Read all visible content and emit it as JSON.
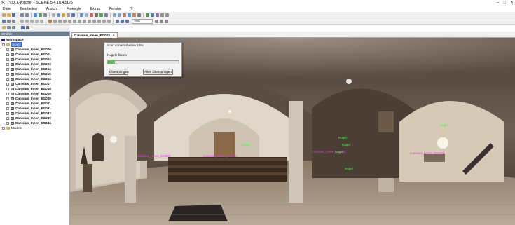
{
  "app": {
    "title": "\"VOLL-Kirche\" - SCENE 5.4.10.43125",
    "window_buttons": [
      "–",
      "□",
      "✕"
    ]
  },
  "menu": [
    "Datei",
    "Bearbeiten",
    "Ansicht",
    "Freestyle",
    "Extras",
    "Fenster",
    "?"
  ],
  "toolbar": {
    "zoom_value": "10%"
  },
  "sidebar": {
    "panel_title": "Struktur",
    "workspace_label": "Workspace",
    "scans_label": "Scans",
    "models_label": "Models",
    "scans": [
      "Canisius_Innen_EG000",
      "Canisius_Innen_EG001",
      "Canisius_Innen_EG002",
      "Canisius_Innen_EG003",
      "Canisius_Innen_EG014",
      "Canisius_Innen_EG015",
      "Canisius_Innen_EG016",
      "Canisius_Innen_EG017",
      "Canisius_Innen_EG018",
      "Canisius_Innen_EG019",
      "Canisius_Innen_EG020",
      "Canisius_Innen_EG021",
      "Canisius_Innen_EG031",
      "Canisius_Innen_EG032",
      "Canisius_Innen_EG033",
      "Canisius_Innen_EG034"
    ]
  },
  "tab": {
    "label": "Canisius_Innen_EG003",
    "close": "×"
  },
  "dialog": {
    "title": "Scan vorverarbeiten 18%",
    "step_label": "Kugeln finden",
    "progress": 0.1,
    "skip_label": "Überspringen",
    "skip_all_label": "Alles Überspringen"
  },
  "annotations": {
    "mag_left": "Canisius_Innen_EG000",
    "mag_mid": "Canisius_Innen_EG001",
    "mag_right": "Canisius_Innen_EG002",
    "mag_far": "Canisius_Innen_EG034",
    "green_a": "Kugel",
    "green_b": "Kugel",
    "green_c": "Kugel",
    "green_d": "Kugel",
    "green_e": "Kugel",
    "green_f": "Kugel"
  },
  "colors": {
    "selection": "#3a6bc9",
    "progress": "#4fc24f",
    "annotation_green": "#3cff3c",
    "annotation_magenta": "#e040e0"
  }
}
